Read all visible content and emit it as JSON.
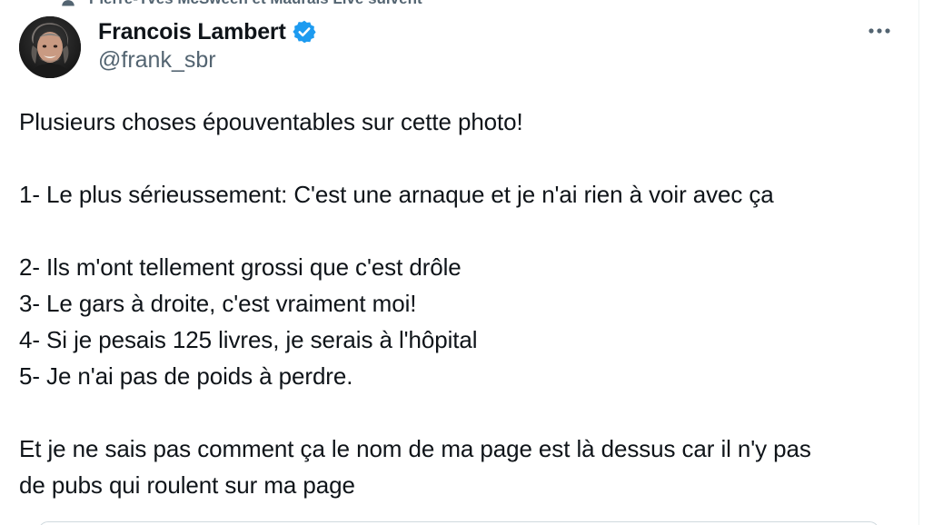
{
  "social_context": {
    "text": "Pierre-Yves McSween et Maurais Live suivent",
    "icon": "person-icon"
  },
  "author": {
    "display_name": "Francois Lambert",
    "handle": "@frank_sbr",
    "verified": true,
    "verified_color": "#1d9bf0",
    "avatar": "avatar-photo"
  },
  "more_button": {
    "icon": "more-horizontal-icon"
  },
  "tweet": {
    "lines": [
      "Plusieurs choses épouventables sur cette photo!",
      "",
      "1- Le plus sérieussement: C'est une arnaque et je n'ai rien à voir avec ça",
      "",
      "2- Ils m'ont tellement grossi que c'est drôle",
      "3- Le gars à droite, c'est vraiment moi!",
      "4- Si je pesais 125 livres, je serais à l'hôpital",
      "5- Je n'ai pas de poids à perdre.",
      "",
      "Et je ne sais pas comment ça le nom de ma page est là dessus car il n'y pas",
      "de pubs qui roulent sur ma page"
    ]
  },
  "colors": {
    "text_primary": "#0f1419",
    "text_secondary": "#536471",
    "border": "#eff3f4"
  }
}
